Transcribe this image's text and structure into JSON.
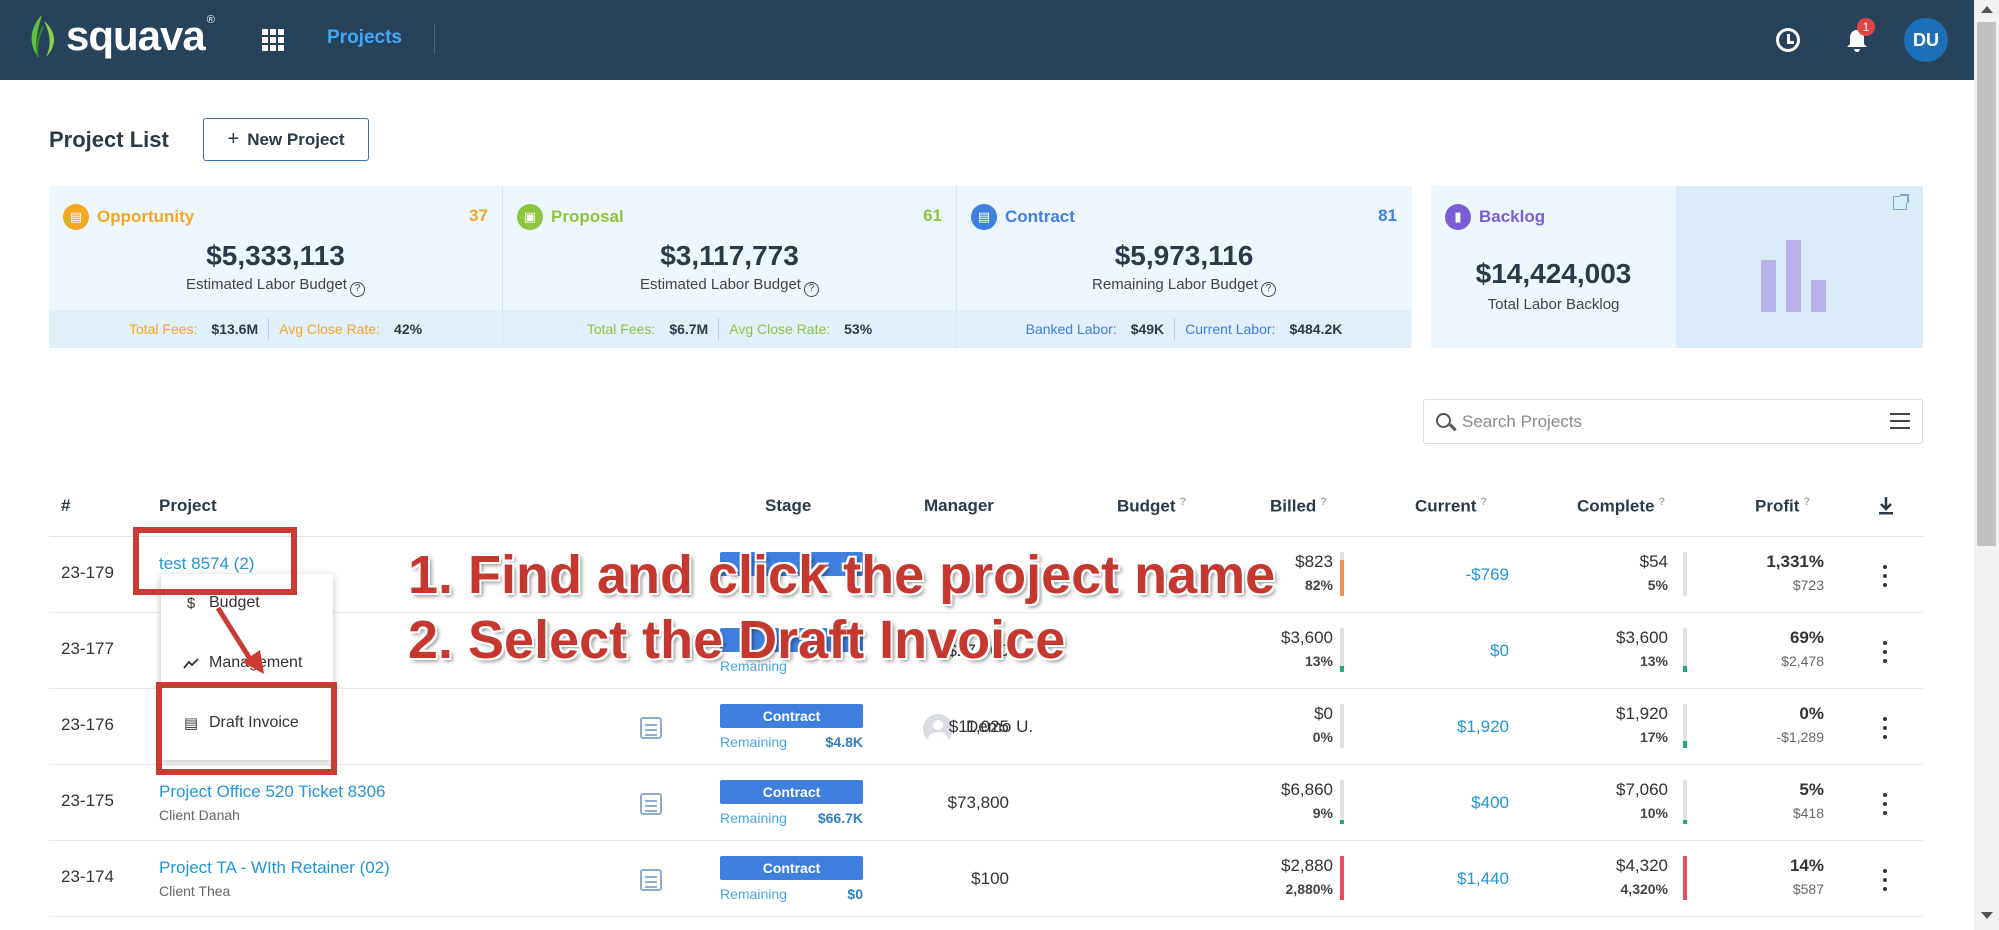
{
  "header": {
    "logo_text": "squava",
    "logo_tm": "®",
    "nav_projects": "Projects",
    "notification_count": "1",
    "user_initials": "DU"
  },
  "page": {
    "title": "Project List",
    "new_project_label": "New Project"
  },
  "cards": [
    {
      "label": "Opportunity",
      "count": "37",
      "amount": "$5,333,113",
      "sub": "Estimated Labor Budget",
      "color": "#f5a623",
      "foot": [
        {
          "label": "Total Fees:",
          "value": "$13.6M"
        },
        {
          "label": "Avg Close Rate:",
          "value": "42%"
        }
      ]
    },
    {
      "label": "Proposal",
      "count": "61",
      "amount": "$3,117,773",
      "sub": "Estimated Labor Budget",
      "color": "#8cc63f",
      "foot": [
        {
          "label": "Total Fees:",
          "value": "$6.7M"
        },
        {
          "label": "Avg Close Rate:",
          "value": "53%"
        }
      ]
    },
    {
      "label": "Contract",
      "count": "81",
      "amount": "$5,973,116",
      "sub": "Remaining Labor Budget",
      "color": "#3f7fdf",
      "foot": [
        {
          "label": "Banked Labor:",
          "value": "$49K"
        },
        {
          "label": "Current Labor:",
          "value": "$484.2K"
        }
      ]
    }
  ],
  "backlog": {
    "label": "Backlog",
    "amount": "$14,424,003",
    "sub": "Total Labor Backlog",
    "color": "#7b5ed6"
  },
  "search": {
    "placeholder": "Search Projects"
  },
  "table": {
    "headers": {
      "num": "#",
      "project": "Project",
      "stage": "Stage",
      "manager": "Manager",
      "budget": "Budget",
      "billed": "Billed",
      "current": "Current",
      "complete": "Complete",
      "profit": "Profit"
    },
    "rows": [
      {
        "num": "23-179",
        "name": "test 8574 (2)",
        "client": "",
        "stage": "",
        "rem_label": "",
        "rem_value": "",
        "manager": "",
        "budget": "",
        "billed": "$823",
        "billed_pct": "82%",
        "billed_fill": 0.82,
        "billed_color": "#f0914f",
        "current": "-$769",
        "complete": "$54",
        "complete_pct": "5%",
        "complete_fill": 0.05,
        "complete_color": "#dfe3e6",
        "profit_pct": "1,331%",
        "profit_amt": "$723"
      },
      {
        "num": "23-177",
        "name": "",
        "client": "",
        "stage": "",
        "rem_label": "Remaining",
        "rem_value": "",
        "manager": "",
        "budget": "$27,900",
        "billed": "$3,600",
        "billed_pct": "13%",
        "billed_fill": 0.13,
        "billed_color": "#1fb07a",
        "current": "$0",
        "complete": "$3,600",
        "complete_pct": "13%",
        "complete_fill": 0.13,
        "complete_color": "#1fb07a",
        "profit_pct": "69%",
        "profit_amt": "$2,478"
      },
      {
        "num": "23-176",
        "name": "",
        "client": "",
        "stage": "Contract",
        "rem_label": "Remaining",
        "rem_value": "$4.8K",
        "manager": "Demo U.",
        "budget": "$11,025",
        "billed": "$0",
        "billed_pct": "0%",
        "billed_fill": 0,
        "billed_color": "#1fb07a",
        "current": "$1,920",
        "complete": "$1,920",
        "complete_pct": "17%",
        "complete_fill": 0.17,
        "complete_color": "#1fb07a",
        "profit_pct": "0%",
        "profit_amt": "-$1,289"
      },
      {
        "num": "23-175",
        "name": "Project Office 520 Ticket 8306",
        "client": "Client Danah",
        "stage": "Contract",
        "rem_label": "Remaining",
        "rem_value": "$66.7K",
        "manager": "",
        "budget": "$73,800",
        "billed": "$6,860",
        "billed_pct": "9%",
        "billed_fill": 0.09,
        "billed_color": "#1fb07a",
        "current": "$400",
        "complete": "$7,060",
        "complete_pct": "10%",
        "complete_fill": 0.1,
        "complete_color": "#1fb07a",
        "profit_pct": "5%",
        "profit_amt": "$418"
      },
      {
        "num": "23-174",
        "name": "Project TA - WIth Retainer (02)",
        "client": "Client Thea",
        "stage": "Contract",
        "rem_label": "Remaining",
        "rem_value": "$0",
        "manager": "",
        "budget": "$100",
        "billed": "$2,880",
        "billed_pct": "2,880%",
        "billed_fill": 1,
        "billed_color": "#ea4c5b",
        "current": "$1,440",
        "complete": "$4,320",
        "complete_pct": "4,320%",
        "complete_fill": 1,
        "complete_color": "#ea4c5b",
        "profit_pct": "14%",
        "profit_amt": "$587"
      }
    ]
  },
  "dropdown": {
    "items": [
      {
        "icon": "$",
        "label": "Budget"
      },
      {
        "icon": "~",
        "label": "Management"
      },
      {
        "icon": "▤",
        "label": "Draft Invoice"
      }
    ]
  },
  "annotation": {
    "step1": "1. Find and click the project name",
    "step2": "2. Select the Draft Invoice"
  }
}
